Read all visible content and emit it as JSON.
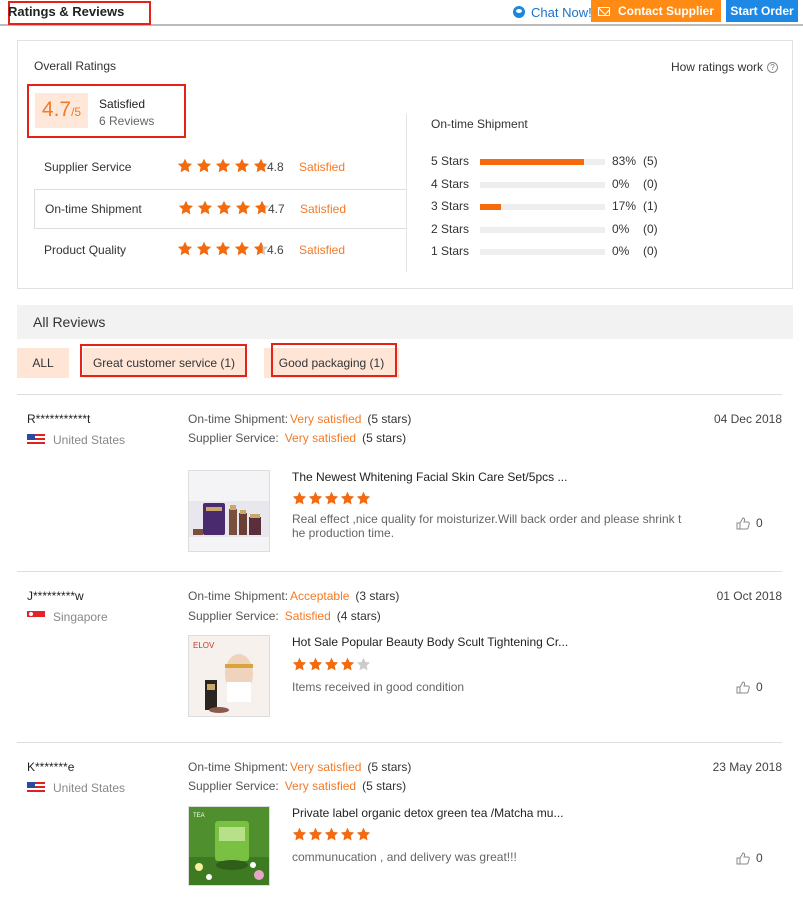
{
  "header": {
    "title": "Ratings & Reviews",
    "chat_label": "Chat Now!",
    "contact_label": "Contact Supplier",
    "start_order_label": "Start Order"
  },
  "overall": {
    "title": "Overall Ratings",
    "how_label": "How ratings work",
    "score": "4.7",
    "score_out_of": "/5",
    "score_word": "Satisfied",
    "review_count": "6 Reviews",
    "rows": [
      {
        "label": "Supplier Service",
        "value": "4.8",
        "status": "Satisfied",
        "stars": 4.8
      },
      {
        "label": "On-time Shipment",
        "value": "4.7",
        "status": "Satisfied",
        "stars": 4.7
      },
      {
        "label": "Product Quality",
        "value": "4.6",
        "status": "Satisfied",
        "stars": 4.6
      }
    ],
    "distribution_title": "On-time Shipment",
    "distribution": [
      {
        "label": "5 Stars",
        "pct": "83%",
        "count": "(5)",
        "fraction": 0.83
      },
      {
        "label": "4 Stars",
        "pct": "0%",
        "count": "(0)",
        "fraction": 0
      },
      {
        "label": "3 Stars",
        "pct": "17%",
        "count": "(1)",
        "fraction": 0.17
      },
      {
        "label": "2 Stars",
        "pct": "0%",
        "count": "(0)",
        "fraction": 0
      },
      {
        "label": "1 Stars",
        "pct": "0%",
        "count": "(0)",
        "fraction": 0
      }
    ]
  },
  "all_reviews": {
    "title": "All Reviews",
    "filters": [
      "ALL",
      "Great customer service (1)",
      "Good packaging (1)"
    ]
  },
  "reviews": [
    {
      "user": "R***********t",
      "country": "United States",
      "flag": "us",
      "date": "04 Dec 2018",
      "shipment_label": "On-time Shipment:",
      "shipment_status": "Very satisfied",
      "shipment_stars": "(5 stars)",
      "service_label": "Supplier Service:",
      "service_status": "Very satisfied",
      "service_stars": "(5 stars)",
      "product": "The Newest Whitening Facial Skin Care Set/5pcs ...",
      "rating": 5,
      "text": "Real effect ,nice quality for moisturizer.Will back order and please shrink t he production time.",
      "likes": "0"
    },
    {
      "user": "J*********w",
      "country": "Singapore",
      "flag": "sg",
      "date": "01 Oct 2018",
      "shipment_label": "On-time Shipment:",
      "shipment_status": "Acceptable",
      "shipment_stars": "(3 stars)",
      "service_label": "Supplier Service:",
      "service_status": "Satisfied",
      "service_stars": "(4 stars)",
      "product": "Hot Sale Popular Beauty Body Scult Tightening Cr...",
      "rating": 4,
      "text": "Items received in good condition",
      "likes": "0"
    },
    {
      "user": "K*******e",
      "country": "United States",
      "flag": "us",
      "date": "23 May 2018",
      "shipment_label": "On-time Shipment:",
      "shipment_status": "Very satisfied",
      "shipment_stars": "(5 stars)",
      "service_label": "Supplier Service:",
      "service_status": "Very satisfied",
      "service_stars": "(5 stars)",
      "product": "Private label organic detox green tea /Matcha mu...",
      "rating": 5,
      "text": "communucation , and delivery was great!!!",
      "likes": "0"
    }
  ],
  "colors": {
    "accent": "#f47a26",
    "star": "#f46a0c",
    "star_empty": "#cccccc",
    "highlight": "#e62117",
    "contact_button": "#ff8b14",
    "start_button": "#1e88e5"
  }
}
